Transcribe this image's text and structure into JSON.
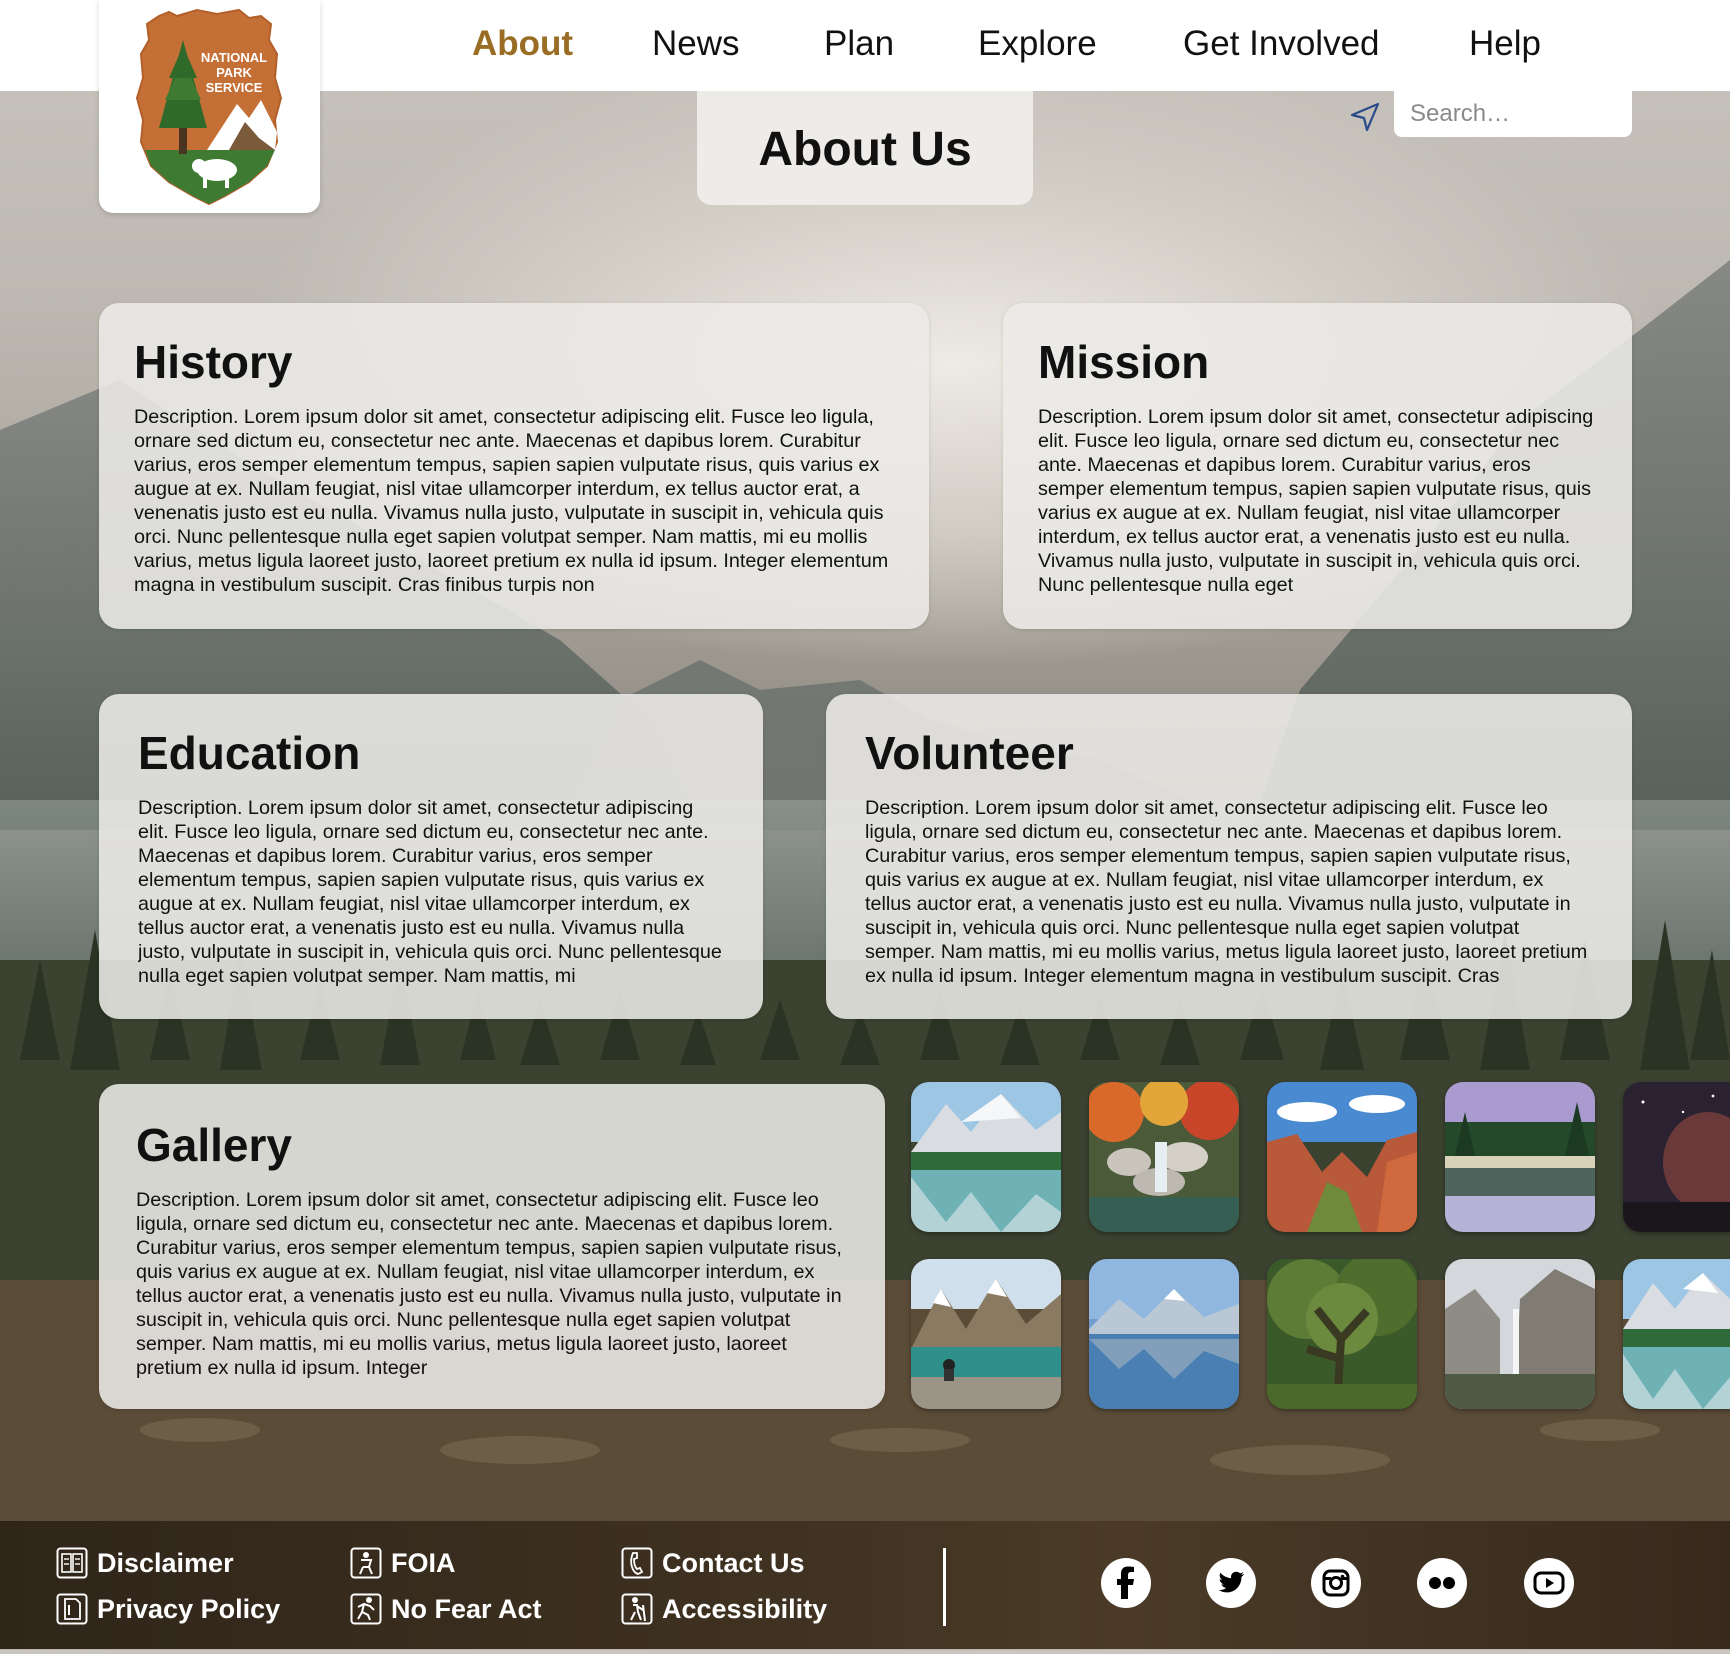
{
  "nav": {
    "logo": {
      "line1": "NATIONAL",
      "line2": "PARK",
      "line3": "SERVICE"
    },
    "items": [
      {
        "label": "About",
        "active": true
      },
      {
        "label": "News"
      },
      {
        "label": "Plan"
      },
      {
        "label": "Explore"
      },
      {
        "label": "Get Involved"
      },
      {
        "label": "Help"
      }
    ]
  },
  "search": {
    "placeholder": "Search…",
    "icon": "location-arrow-icon"
  },
  "page": {
    "title": "About Us"
  },
  "sections": {
    "history": {
      "title": "History",
      "body": "Description. Lorem ipsum dolor sit amet, consectetur adipiscing elit. Fusce leo ligula, ornare sed dictum eu, consectetur nec ante. Maecenas et dapibus lorem. Curabitur varius, eros semper elementum tempus, sapien sapien vulputate risus, quis varius ex augue at ex. Nullam feugiat, nisl vitae ullamcorper interdum, ex tellus auctor erat, a venenatis justo est eu nulla. Vivamus nulla justo, vulputate in suscipit in, vehicula quis orci. Nunc pellentesque nulla eget sapien volutpat semper. Nam mattis, mi eu mollis varius, metus ligula laoreet justo, laoreet pretium ex nulla id ipsum. Integer elementum magna in vestibulum suscipit. Cras finibus turpis non"
    },
    "mission": {
      "title": "Mission",
      "body": "Description. Lorem ipsum dolor sit amet, consectetur adipiscing elit. Fusce leo ligula, ornare sed dictum eu, consectetur nec ante. Maecenas et dapibus lorem. Curabitur varius, eros semper elementum tempus, sapien sapien vulputate risus, quis varius ex augue at ex. Nullam feugiat, nisl vitae ullamcorper interdum, ex tellus auctor erat, a venenatis justo est eu nulla. Vivamus nulla justo, vulputate in suscipit in, vehicula quis orci. Nunc pellentesque nulla eget"
    },
    "education": {
      "title": "Education",
      "body": "Description. Lorem ipsum dolor sit amet, consectetur adipiscing elit. Fusce leo ligula, ornare sed dictum eu, consectetur nec ante. Maecenas et dapibus lorem. Curabitur varius, eros semper elementum tempus, sapien sapien vulputate risus, quis varius ex augue at ex. Nullam feugiat, nisl vitae ullamcorper interdum, ex tellus auctor erat, a venenatis justo est eu nulla. Vivamus nulla justo, vulputate in suscipit in, vehicula quis orci. Nunc pellentesque nulla eget sapien volutpat semper. Nam mattis, mi"
    },
    "volunteer": {
      "title": "Volunteer",
      "body": "Description. Lorem ipsum dolor sit amet, consectetur adipiscing elit. Fusce leo ligula, ornare sed dictum eu, consectetur nec ante. Maecenas et dapibus lorem. Curabitur varius, eros semper elementum tempus, sapien sapien vulputate risus, quis varius ex augue at ex. Nullam feugiat, nisl vitae ullamcorper interdum, ex tellus auctor erat, a venenatis justo est eu nulla. Vivamus nulla justo, vulputate in suscipit in, vehicula quis orci. Nunc pellentesque nulla eget sapien volutpat semper. Nam mattis, mi eu mollis varius, metus ligula laoreet justo, laoreet pretium ex nulla id ipsum. Integer elementum magna in vestibulum suscipit. Cras"
    },
    "gallery": {
      "title": "Gallery",
      "body": "Description. Lorem ipsum dolor sit amet, consectetur adipiscing elit. Fusce leo ligula, ornare sed dictum eu, consectetur nec ante. Maecenas et dapibus lorem. Curabitur varius, eros semper elementum tempus, sapien sapien vulputate risus, quis varius ex augue at ex. Nullam feugiat, nisl vitae ullamcorper interdum, ex tellus auctor erat, a venenatis justo est eu nulla. Vivamus nulla justo, vulputate in suscipit in, vehicula quis orci. Nunc pellentesque nulla eget sapien volutpat semper. Nam mattis, mi eu mollis varius, metus ligula laoreet justo, laoreet pretium ex nulla id ipsum. Integer"
    }
  },
  "gallery_thumbs": [
    {
      "subject": "mountain-lake-reflection"
    },
    {
      "subject": "waterfall-autumn-garden"
    },
    {
      "subject": "red-rock-canyon"
    },
    {
      "subject": "forest-lake-reflection"
    },
    {
      "subject": "night-sky-rock"
    },
    {
      "subject": "alpine-lake-hikers"
    },
    {
      "subject": "lake-mountain-reflection"
    },
    {
      "subject": "mossy-forest-tree"
    },
    {
      "subject": "yosemite-waterfall"
    },
    {
      "subject": "mountain-lake-reflection"
    }
  ],
  "footer": {
    "links": [
      {
        "label": "Disclaimer",
        "icon": "document-icon"
      },
      {
        "label": "Privacy Policy",
        "icon": "privacy-document-icon"
      },
      {
        "label": "FOIA",
        "icon": "person-icon"
      },
      {
        "label": "No Fear Act",
        "icon": "running-person-icon"
      },
      {
        "label": "Contact Us",
        "icon": "phone-icon"
      },
      {
        "label": "Accessibility",
        "icon": "hiker-icon"
      }
    ],
    "social": [
      {
        "name": "facebook-icon"
      },
      {
        "name": "twitter-icon"
      },
      {
        "name": "instagram-icon"
      },
      {
        "name": "flickr-icon"
      },
      {
        "name": "youtube-icon"
      }
    ]
  },
  "colors": {
    "nav_active": "#9a6d25",
    "nps_brown": "#c46f35",
    "nps_green": "#3f7a32",
    "card_bg": "#eceae7",
    "footer_bg": "#3d3020"
  }
}
